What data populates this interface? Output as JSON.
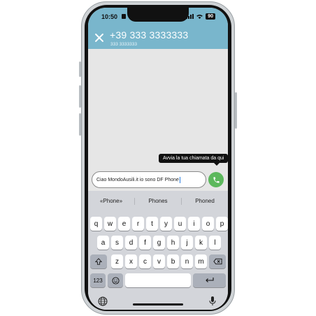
{
  "status": {
    "time": "10:50",
    "battery": "90"
  },
  "header": {
    "title": "+39 333 3333333",
    "subtitle": "333 3333333"
  },
  "tooltip": "Avvia la tua chiamata da qui",
  "message_input": {
    "value": "Ciao MondoAusili.it io sono DF Phone"
  },
  "suggestions": [
    "«Phone»",
    "Phones",
    "Phoned"
  ],
  "keyboard": {
    "row1": [
      "q",
      "w",
      "e",
      "r",
      "t",
      "y",
      "u",
      "i",
      "o",
      "p"
    ],
    "row2": [
      "a",
      "s",
      "d",
      "f",
      "g",
      "h",
      "j",
      "k",
      "l"
    ],
    "row3": [
      "z",
      "x",
      "c",
      "v",
      "b",
      "n",
      "m"
    ],
    "numbers_key": "123",
    "space_key": "",
    "icons": {
      "shift": "shift-icon",
      "backspace": "backspace-icon",
      "emoji": "emoji-icon",
      "return": "return-icon",
      "globe": "globe-icon",
      "mic": "microphone-icon"
    }
  },
  "colors": {
    "header": "#79b6cc",
    "call_button": "#5cb85c",
    "keyboard_bg": "#d3d5da"
  }
}
